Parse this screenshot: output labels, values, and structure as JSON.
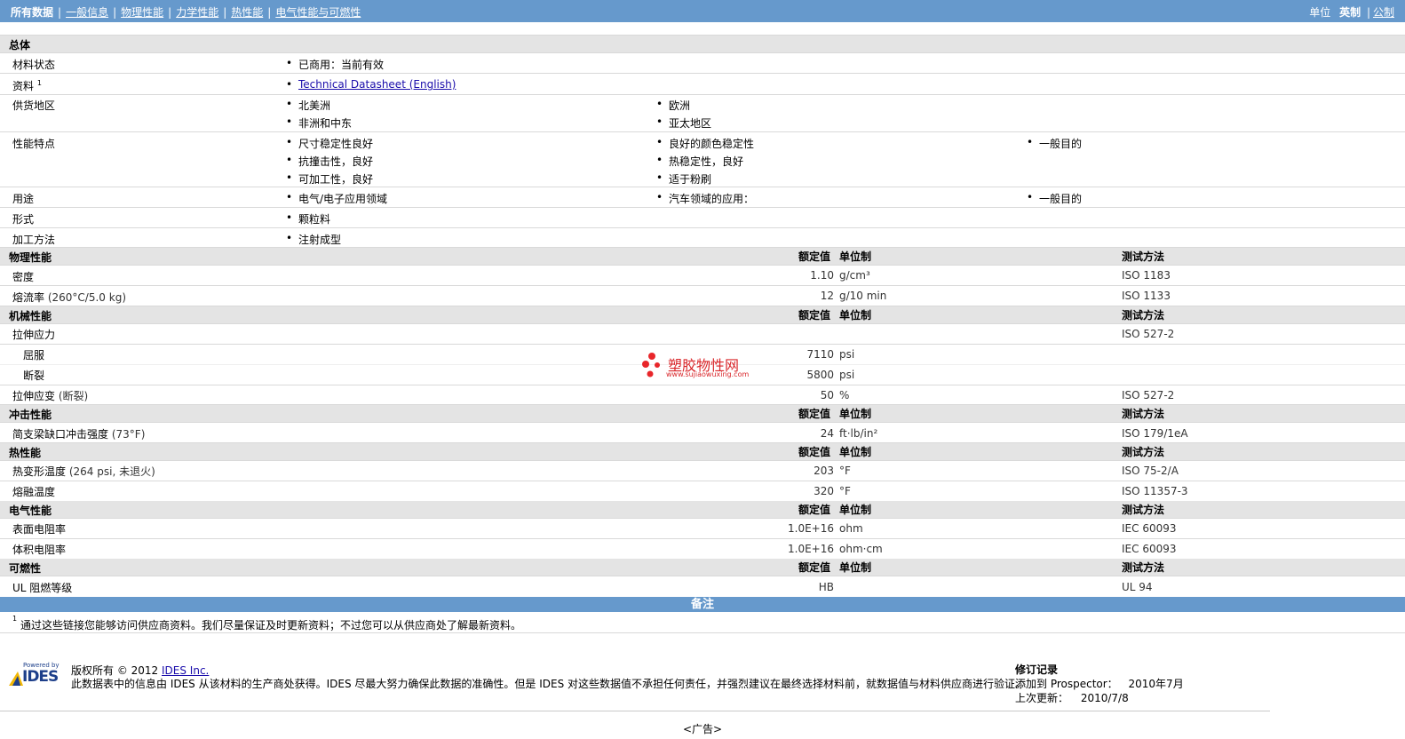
{
  "nav": {
    "tabs": [
      "所有数据",
      "一般信息",
      "物理性能",
      "力学性能",
      "热性能",
      "电气性能与可燃性"
    ],
    "units_label": "单位",
    "unit_english": "英制",
    "unit_metric": "公制"
  },
  "general": {
    "title": "总体",
    "material_status_label": "材料状态",
    "material_status_value": "已商用：当前有效",
    "docs_label": "资料",
    "docs_sup": "1",
    "docs_link": "Technical Datasheet (English)",
    "regions_label": "供货地区",
    "regions": [
      "北美洲",
      "欧洲",
      "非洲和中东",
      "亚太地区"
    ],
    "features_label": "性能特点",
    "features": [
      "尺寸稳定性良好",
      "良好的颜色稳定性",
      "一般目的",
      "抗撞击性，良好",
      "热稳定性，良好",
      "可加工性，良好",
      "适于粉刷"
    ],
    "uses_label": "用途",
    "uses": [
      "电气/电子应用领域",
      "汽车领域的应用：",
      "一般目的"
    ],
    "form_label": "形式",
    "form_value": "颗粒料",
    "processing_label": "加工方法",
    "processing_value": "注射成型"
  },
  "headers": {
    "nominal": "额定值",
    "unit": "单位制",
    "test": "测试方法"
  },
  "physical": {
    "title": "物理性能",
    "density_label": "密度",
    "density_value": "1.10",
    "density_unit": "g/cm³",
    "density_test": "ISO 1183",
    "mfr_label": "熔流率",
    "mfr_cond": "(260°C/5.0 kg)",
    "mfr_value": "12",
    "mfr_unit": "g/10 min",
    "mfr_test": "ISO 1133"
  },
  "mechanical": {
    "title": "机械性能",
    "tensile_label": "拉伸应力",
    "tensile_test": "ISO 527-2",
    "yield_label": "屈服",
    "yield_value": "7110",
    "yield_unit": "psi",
    "break_label": "断裂",
    "break_value": "5800",
    "break_unit": "psi",
    "strain_label": "拉伸应变",
    "strain_cond": "(断裂)",
    "strain_value": "50",
    "strain_unit": "%",
    "strain_test": "ISO 527-2"
  },
  "impact": {
    "title": "冲击性能",
    "charpy_label": "简支梁缺口冲击强度",
    "charpy_cond": "(73°F)",
    "charpy_value": "24",
    "charpy_unit": "ft·lb/in²",
    "charpy_test": "ISO 179/1eA"
  },
  "thermal": {
    "title": "热性能",
    "hdt_label": "热变形温度",
    "hdt_cond": "(264 psi, 未退火)",
    "hdt_value": "203",
    "hdt_unit": "°F",
    "hdt_test": "ISO 75-2/A",
    "melt_label": "熔融温度",
    "melt_value": "320",
    "melt_unit": "°F",
    "melt_test": "ISO 11357-3"
  },
  "electrical": {
    "title": "电气性能",
    "surface_label": "表面电阻率",
    "surface_value": "1.0E+16",
    "surface_unit": "ohm",
    "surface_test": "IEC 60093",
    "volume_label": "体积电阻率",
    "volume_value": "1.0E+16",
    "volume_unit": "ohm·cm",
    "volume_test": "IEC 60093"
  },
  "flammability": {
    "title": "可燃性",
    "ul_label": "UL 阻燃等级",
    "ul_value": "HB",
    "ul_test": "UL 94"
  },
  "watermark": {
    "name": "塑胶物性网",
    "url": "www.sujiaowuxing.com"
  },
  "notes": {
    "title": "备注",
    "note_sup": "1",
    "note_text": "通过这些链接您能够访问供应商资料。我们尽量保证及时更新资料；不过您可以从供应商处了解最新资料。"
  },
  "footer": {
    "powered_by": "Powered by",
    "logo": "IDES",
    "copyright": "版权所有 © 2012",
    "ides_link": "IDES Inc.",
    "disclaimer": "此数据表中的信息由 IDES 从该材料的生产商处获得。IDES 尽最大努力确保此数据的准确性。但是 IDES 对这些数据值不承担任何责任，并强烈建议在最终选择材料前，就数据值与材料供应商进行验证。",
    "revision_title": "修订记录",
    "added_label": "添加到 Prospector：",
    "added_value": "2010年7月",
    "updated_label": "上次更新：",
    "updated_value": "2010/7/8",
    "ad": "<广告>"
  }
}
